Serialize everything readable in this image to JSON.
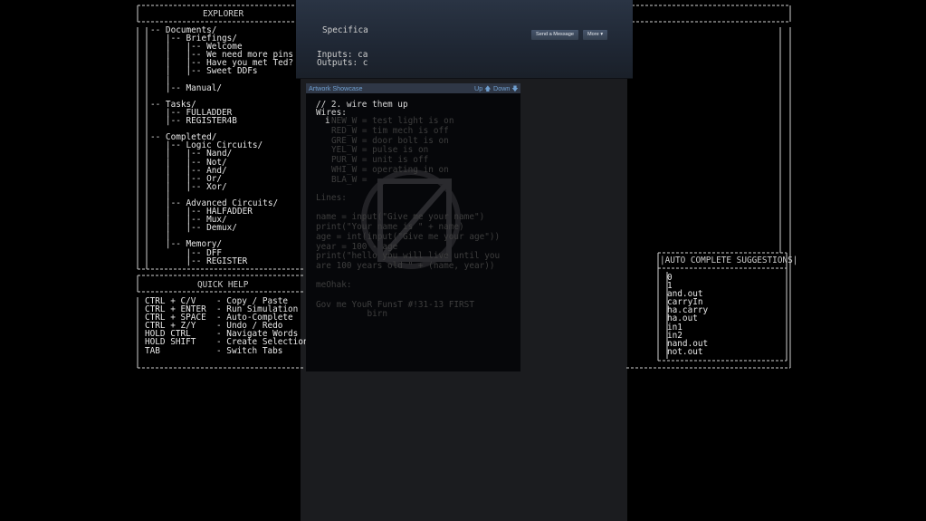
{
  "explorer": {
    "title": "EXPLORER",
    "tree": [
      "-- Documents/",
      "   |-- Briefings/",
      "   |   |-- Welcome",
      "   |   |-- We need more pins",
      "   |   |-- Have you met Ted?",
      "   |   |-- Sweet DDFs",
      "   |",
      "   |-- Manual/",
      "",
      "-- Tasks/",
      "   |-- FULLADDER",
      "   |-- REGISTER4B",
      "",
      "-- Completed/",
      "   |-- Logic Circuits/",
      "   |   |-- Nand/",
      "   |   |-- Not/",
      "   |   |-- And/",
      "   |   |-- Or/",
      "   |   |-- Xor/",
      "   |",
      "   |-- Advanced Circuits/",
      "   |   |-- HALFADDER",
      "   |   |-- Mux/",
      "   |   |-- Demux/",
      "   |",
      "   |-- Memory/",
      "       |-- DFF",
      "       |-- REGISTER"
    ]
  },
  "quick_help": {
    "title": "QUICK HELP",
    "lines": [
      "CTRL + C/V    - Copy / Paste",
      "CTRL + ENTER  - Run Simulation",
      "CTRL + SPACE  - Auto-Complete",
      "CTRL + Z/Y    - Undo / Redo",
      "HOLD CTRL     - Navigate Words",
      "HOLD SHIFT    - Create Selection",
      "TAB           - Switch Tabs"
    ]
  },
  "spec": {
    "title": "Specifica",
    "inputs": "Inputs: ca",
    "outputs": "Outputs: c"
  },
  "autocomplete": {
    "title": "AUTO COMPLETE SUGGESTIONS",
    "items": [
      "0",
      "1",
      "and.out",
      "carryIn",
      "ha.carry",
      "ha.out",
      "in1",
      "in2",
      "nand.out",
      "not.out"
    ]
  },
  "steam": {
    "send_message": "Send a Message",
    "more": "More",
    "showcase_title": "Artwork Showcase",
    "up": "Up",
    "down": "Down"
  },
  "editor": {
    "comment": "// 2. wire them up",
    "wires_label": "Wires:",
    "cursor_line": "i",
    "ghost_lines": [
      "RED_W = tim mech is off",
      "GRE_W = door bolt is on",
      "YEL_W = pulse is on",
      "PUR_W = unit is off",
      "WHI_W = operating in on",
      "BLA_W ="
    ],
    "ghost_first": "NEW_W = test light is on",
    "ghost_block": [
      "Lines:",
      "",
      "name = input(\"Give me your name\")",
      "print(\"Your name is \" + name)",
      "age = int(input(\"Give me your age\"))",
      "year = 100 - age",
      "print(\"hello you will live until you",
      "are 100 years old \" + (name, year))",
      "",
      "meOhak:",
      "",
      "Gov me YouR FunsT #!31-13 FIRST",
      "          birn"
    ]
  },
  "colors": {
    "background": "#000000",
    "steam_panel": "#1b1c1f",
    "steam_header": "#2a3444",
    "steam_link": "#6f9fd0"
  }
}
